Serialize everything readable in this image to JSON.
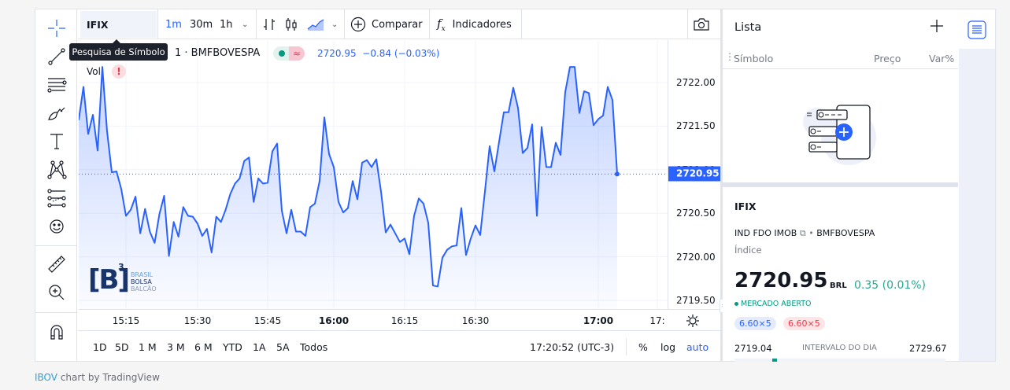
{
  "toolbar": {
    "tools": [
      "crosshair-icon",
      "trend-line-icon",
      "horizontal-lines-icon",
      "brush-icon",
      "text-icon",
      "pattern-icon",
      "fib-icon",
      "emoji-icon",
      "ruler-icon",
      "zoom-in-icon",
      "magnet-icon"
    ]
  },
  "topbar": {
    "symbol": "IFIX",
    "intervals": [
      "1m",
      "30m",
      "1h"
    ],
    "active_interval": "1m",
    "compare_label": "Comparar",
    "indicators_label": "Indicadores"
  },
  "tooltip": "Pesquisa de Símbolo",
  "legend": {
    "interval_exchange": "1 · BMFBOVESPA",
    "price": "2720.95",
    "change": "−0.84 (−0.03%)",
    "vol_label": "Vol"
  },
  "logo": {
    "mark": "B",
    "sup": "3",
    "line1": "BRASIL",
    "line2": "BOLSA",
    "line3": "BALCÃO"
  },
  "bottombar": {
    "ranges": [
      "1D",
      "5D",
      "1 M",
      "3 M",
      "6 M",
      "YTD",
      "1A",
      "5A",
      "Todos"
    ],
    "clock": "17:20:52 (UTC-3)",
    "percent": "%",
    "log": "log",
    "auto": "auto"
  },
  "watchlist": {
    "title": "Lista",
    "col_symbol": "Símbolo",
    "col_price": "Preço",
    "col_change": "Var%"
  },
  "details": {
    "symbol": "IFIX",
    "description": "IND FDO IMOB",
    "exchange": "BMFBOVESPA",
    "type": "Índice",
    "price": "2720.95",
    "currency": "BRL",
    "change": "0.35 (0.01%)",
    "market_status": "MERCADO ABERTO",
    "bid": "6.60×5",
    "ask": "6.60×5",
    "day_low": "2719.04",
    "day_range_label": "INTERVALO DO DIA",
    "day_high": "2729.67",
    "day_range_position": 0.18
  },
  "footer": {
    "link": "IBOV",
    "text": " chart by TradingView"
  },
  "colors": {
    "line": "#2962ff",
    "up": "#089981",
    "down": "#f23645",
    "accent": "#2962ff"
  },
  "chart_data": {
    "type": "area",
    "ylim": [
      2719.4,
      2722.5
    ],
    "yticks": [
      "2722.00",
      "2721.50",
      "2721.00",
      "2720.50",
      "2720.00",
      "2719.50"
    ],
    "xticks": [
      "15:15",
      "15:30",
      "15:45",
      "16:00",
      "16:15",
      "16:30",
      "17:00",
      "17:"
    ],
    "last_price": "2720.95",
    "grid": true,
    "points": [
      [
        "15:05",
        2721.57
      ],
      [
        "15:06",
        2721.95
      ],
      [
        "15:07",
        2721.41
      ],
      [
        "15:08",
        2721.63
      ],
      [
        "15:09",
        2721.22
      ],
      [
        "15:10",
        2722.18
      ],
      [
        "15:11",
        2721.44
      ],
      [
        "15:12",
        2720.97
      ],
      [
        "15:13",
        2720.98
      ],
      [
        "15:14",
        2720.78
      ],
      [
        "15:15",
        2720.47
      ],
      [
        "15:16",
        2720.54
      ],
      [
        "15:17",
        2720.69
      ],
      [
        "15:18",
        2720.27
      ],
      [
        "15:19",
        2720.55
      ],
      [
        "15:20",
        2720.29
      ],
      [
        "15:21",
        2720.16
      ],
      [
        "15:22",
        2720.49
      ],
      [
        "15:23",
        2720.7
      ],
      [
        "15:24",
        2720.01
      ],
      [
        "15:25",
        2720.4
      ],
      [
        "15:26",
        2720.23
      ],
      [
        "15:27",
        2720.57
      ],
      [
        "15:28",
        2720.47
      ],
      [
        "15:29",
        2720.46
      ],
      [
        "15:30",
        2720.38
      ],
      [
        "15:31",
        2720.24
      ],
      [
        "15:32",
        2720.32
      ],
      [
        "15:33",
        2720.05
      ],
      [
        "15:34",
        2720.46
      ],
      [
        "15:35",
        2720.4
      ],
      [
        "15:36",
        2720.54
      ],
      [
        "15:37",
        2720.72
      ],
      [
        "15:38",
        2720.84
      ],
      [
        "15:39",
        2720.9
      ],
      [
        "15:40",
        2721.1
      ],
      [
        "15:41",
        2721.14
      ],
      [
        "15:42",
        2720.63
      ],
      [
        "15:43",
        2720.9
      ],
      [
        "15:44",
        2720.84
      ],
      [
        "15:45",
        2720.85
      ],
      [
        "15:46",
        2721.21
      ],
      [
        "15:47",
        2721.3
      ],
      [
        "15:48",
        2720.53
      ],
      [
        "15:49",
        2720.27
      ],
      [
        "15:50",
        2720.54
      ],
      [
        "15:51",
        2720.29
      ],
      [
        "15:52",
        2720.29
      ],
      [
        "15:53",
        2720.24
      ],
      [
        "15:54",
        2720.57
      ],
      [
        "15:55",
        2720.61
      ],
      [
        "15:56",
        2720.87
      ],
      [
        "15:57",
        2721.6
      ],
      [
        "15:59",
        2721.18
      ],
      [
        "16:00",
        2721.03
      ],
      [
        "16:01",
        2720.63
      ],
      [
        "16:02",
        2720.51
      ],
      [
        "16:03",
        2720.56
      ],
      [
        "16:04",
        2720.87
      ],
      [
        "16:05",
        2720.66
      ],
      [
        "16:06",
        2721.08
      ],
      [
        "16:07",
        2721.11
      ],
      [
        "16:08",
        2721.03
      ],
      [
        "16:09",
        2721.12
      ],
      [
        "16:10",
        2720.75
      ],
      [
        "16:11",
        2720.28
      ],
      [
        "16:12",
        2720.37
      ],
      [
        "16:13",
        2720.27
      ],
      [
        "16:14",
        2720.17
      ],
      [
        "16:15",
        2720.21
      ],
      [
        "16:16",
        2720.03
      ],
      [
        "16:17",
        2720.47
      ],
      [
        "16:18",
        2720.67
      ],
      [
        "16:19",
        2720.61
      ],
      [
        "16:20",
        2720.39
      ],
      [
        "16:21",
        2719.67
      ],
      [
        "16:22",
        2719.66
      ],
      [
        "16:23",
        2719.99
      ],
      [
        "16:24",
        2720.08
      ],
      [
        "16:25",
        2720.12
      ],
      [
        "16:26",
        2720.13
      ],
      [
        "16:27",
        2720.56
      ],
      [
        "16:28",
        2720.02
      ],
      [
        "16:29",
        2720.21
      ],
      [
        "16:30",
        2720.36
      ],
      [
        "16:31",
        2720.25
      ],
      [
        "16:32",
        2720.75
      ],
      [
        "16:33",
        2721.27
      ],
      [
        "16:34",
        2720.98
      ],
      [
        "16:35",
        2721.32
      ],
      [
        "16:36",
        2721.66
      ],
      [
        "16:37",
        2721.66
      ],
      [
        "16:38",
        2721.94
      ],
      [
        "16:39",
        2721.71
      ],
      [
        "16:40",
        2721.19
      ],
      [
        "16:41",
        2721.25
      ],
      [
        "16:42",
        2721.52
      ],
      [
        "16:43",
        2720.47
      ],
      [
        "16:44",
        2721.49
      ],
      [
        "16:45",
        2721.03
      ],
      [
        "16:46",
        2721.03
      ],
      [
        "16:47",
        2721.31
      ],
      [
        "16:48",
        2721.17
      ],
      [
        "16:49",
        2721.89
      ],
      [
        "16:50",
        2722.18
      ],
      [
        "16:51",
        2722.18
      ],
      [
        "16:52",
        2721.65
      ],
      [
        "16:53",
        2721.9
      ],
      [
        "16:54",
        2721.88
      ],
      [
        "16:55",
        2721.51
      ],
      [
        "17:00",
        2721.58
      ],
      [
        "17:01",
        2721.62
      ],
      [
        "17:02",
        2721.95
      ],
      [
        "17:03",
        2721.8
      ],
      [
        "17:04",
        2720.95
      ]
    ]
  }
}
